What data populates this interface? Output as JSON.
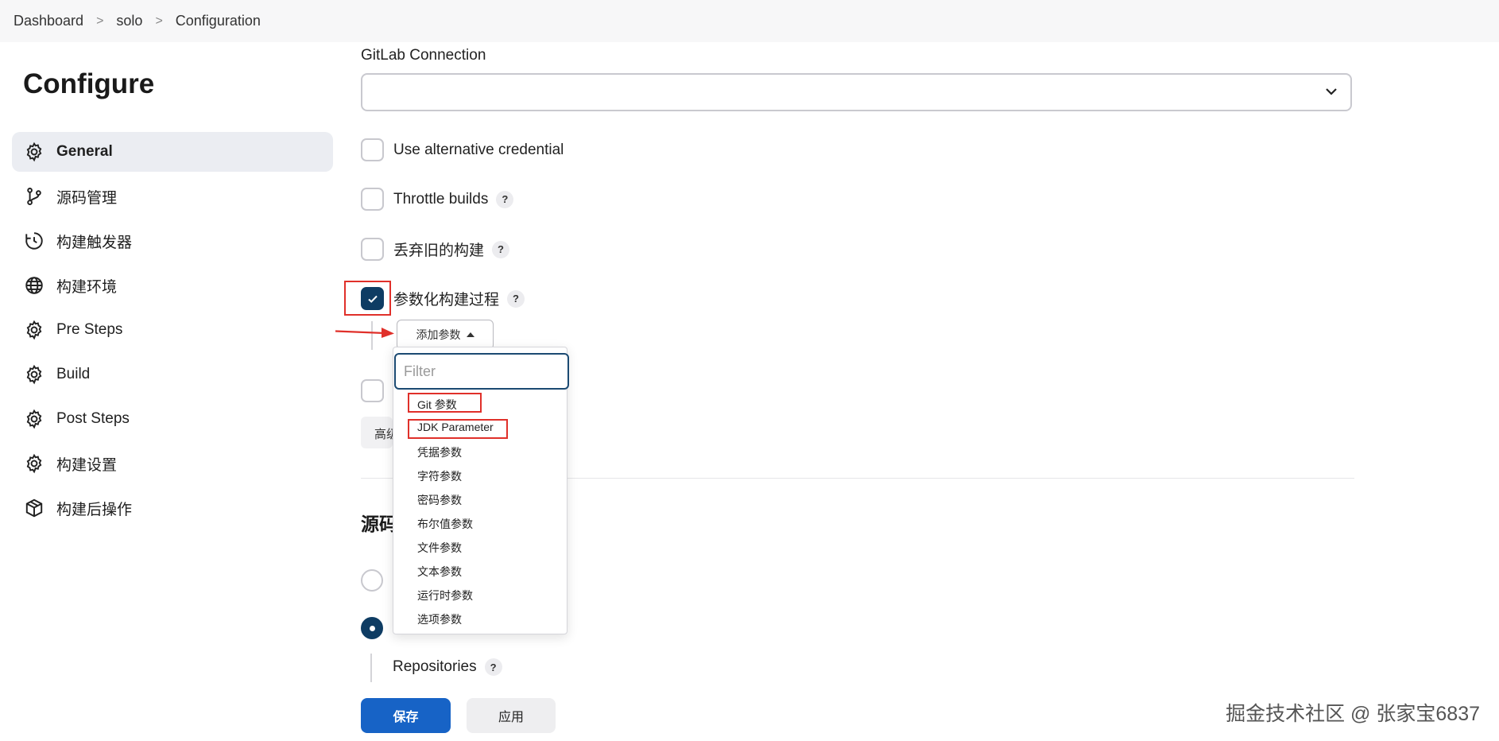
{
  "breadcrumb": {
    "items": [
      "Dashboard",
      "solo",
      "Configuration"
    ]
  },
  "page_title": "Configure",
  "sidebar": {
    "items": [
      {
        "label": "General",
        "icon": "gear-icon",
        "active": true
      },
      {
        "label": "源码管理",
        "icon": "git-branch-icon",
        "active": false
      },
      {
        "label": "构建触发器",
        "icon": "clock-icon",
        "active": false
      },
      {
        "label": "构建环境",
        "icon": "globe-icon",
        "active": false
      },
      {
        "label": "Pre Steps",
        "icon": "gear-icon",
        "active": false
      },
      {
        "label": "Build",
        "icon": "gear-icon",
        "active": false
      },
      {
        "label": "Post Steps",
        "icon": "gear-icon",
        "active": false
      },
      {
        "label": "构建设置",
        "icon": "gear-icon",
        "active": false
      },
      {
        "label": "构建后操作",
        "icon": "package-icon",
        "active": false
      }
    ]
  },
  "form": {
    "gitlab_connection_label": "GitLab Connection",
    "gitlab_connection_value": "",
    "checkboxes": [
      {
        "label": "Use alternative credential",
        "checked": false,
        "help": false
      },
      {
        "label": "Throttle builds",
        "checked": false,
        "help": true
      },
      {
        "label": "丢弃旧的构建",
        "checked": false,
        "help": true
      },
      {
        "label": "参数化构建过程",
        "checked": true,
        "help": true
      }
    ],
    "help_glyph": "?",
    "add_param_label": "添加参数",
    "advanced_label": "高级",
    "section_title": "源码管理",
    "repositories_label": "Repositories"
  },
  "param_menu": {
    "filter_placeholder": "Filter",
    "items": [
      "Git 参数",
      "JDK Parameter",
      "凭据参数",
      "字符参数",
      "密码参数",
      "布尔值参数",
      "文件参数",
      "文本参数",
      "运行时参数",
      "选项参数"
    ]
  },
  "actions": {
    "save_label": "保存",
    "apply_label": "应用"
  },
  "credit": "掘金技术社区 @ 张家宝6837",
  "colors": {
    "accent": "#1763c6",
    "checked": "#0e3c63",
    "highlight_box": "#e0302a",
    "sidebar_active_bg": "#ebedf2"
  }
}
